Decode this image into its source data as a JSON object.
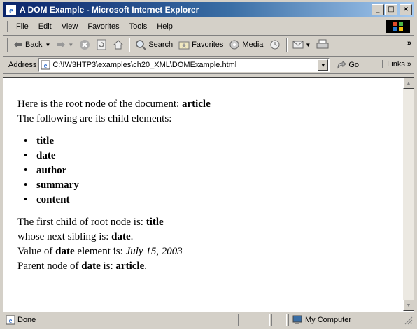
{
  "window": {
    "title": "A DOM Example - Microsoft Internet Explorer"
  },
  "caption_buttons": {
    "minimize": "_",
    "maximize": "□",
    "close": "×"
  },
  "menu": [
    "File",
    "Edit",
    "View",
    "Favorites",
    "Tools",
    "Help"
  ],
  "toolbar": {
    "back": "Back",
    "search": "Search",
    "favorites": "Favorites",
    "media": "Media",
    "more": "»"
  },
  "address": {
    "label": "Address",
    "value": "C:\\IW3HTP3\\examples\\ch20_XML\\DOMExample.html",
    "go": "Go",
    "links": "Links »"
  },
  "content": {
    "root_line_prefix": "Here is the root node of the document: ",
    "root_name": "article",
    "children_intro": "The following are its child elements:",
    "children": [
      "title",
      "date",
      "author",
      "summary",
      "content"
    ],
    "first_child_prefix": "The first child of root node is: ",
    "first_child": "title",
    "sibling_prefix": "whose next sibling is: ",
    "sibling": "date",
    "sibling_suffix": ".",
    "value_prefix": "Value of ",
    "value_element": "date",
    "value_middle": " element is: ",
    "value_text": "July 15, 2003",
    "parent_prefix": "Parent node of ",
    "parent_element": "date",
    "parent_middle": " is: ",
    "parent_name": "article",
    "parent_suffix": "."
  },
  "status": {
    "text": "Done",
    "zone": "My Computer"
  },
  "icons": [
    "ie-icon",
    "windows-logo-icon",
    "back-arrow-icon",
    "forward-arrow-icon",
    "stop-icon",
    "refresh-icon",
    "home-icon",
    "search-icon",
    "favorites-icon",
    "media-icon",
    "history-icon",
    "mail-icon",
    "print-icon",
    "page-icon",
    "go-arrow-icon",
    "computer-icon"
  ]
}
